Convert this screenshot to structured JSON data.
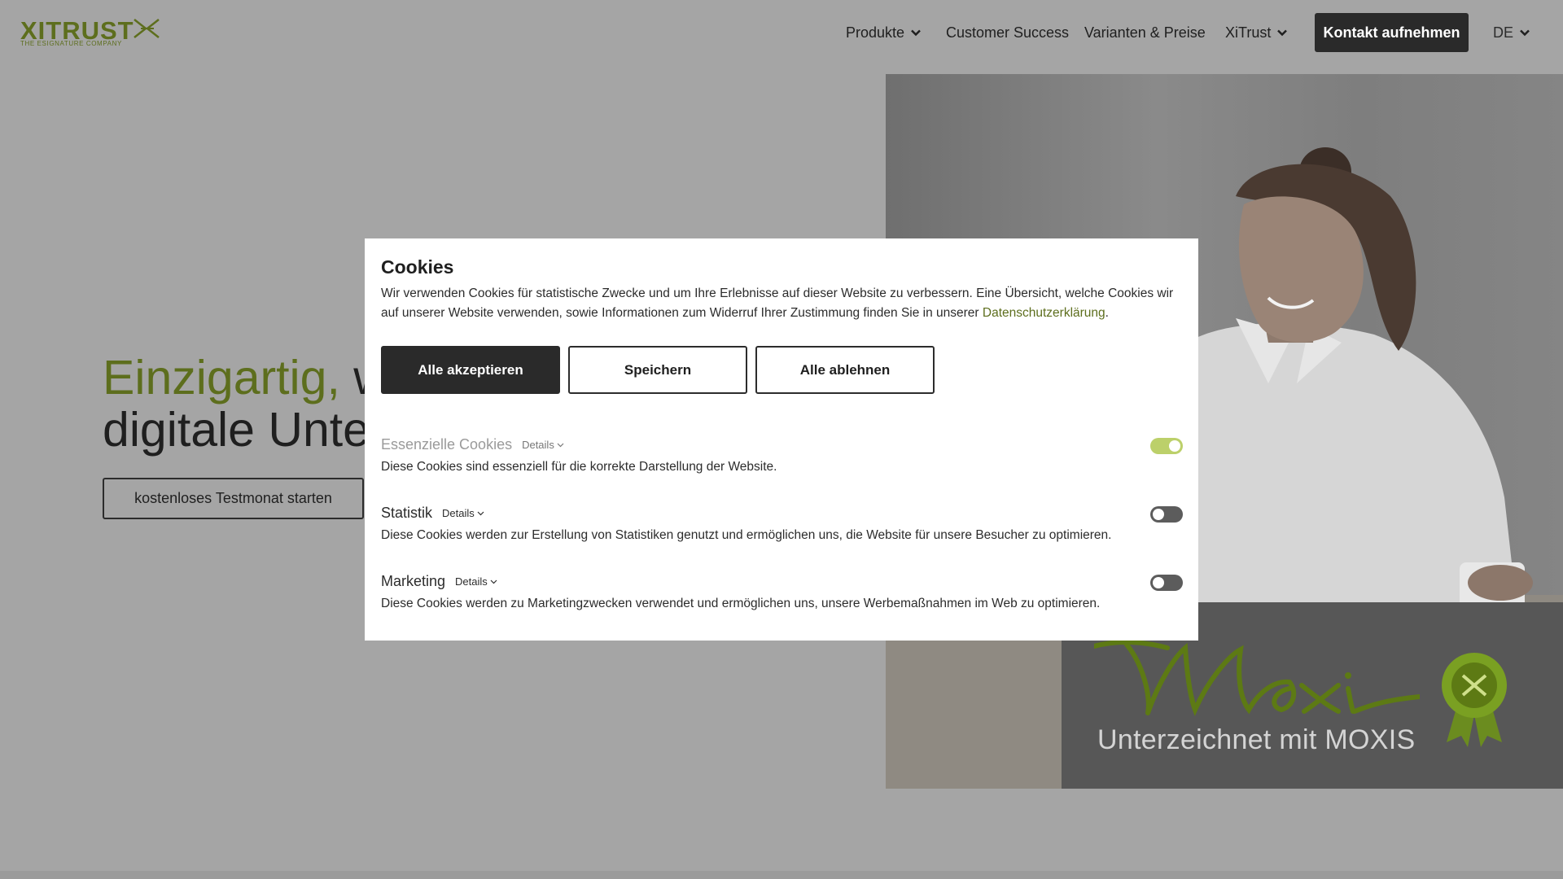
{
  "header": {
    "logo_text": "XITRUST",
    "logo_tagline": "THE ESIGNATURE COMPANY",
    "nav": [
      {
        "label": "Produkte",
        "has_dropdown": true
      },
      {
        "label": "Customer Success",
        "has_dropdown": false
      },
      {
        "label": "Varianten & Preise",
        "has_dropdown": false
      },
      {
        "label": "XiTrust",
        "has_dropdown": true
      }
    ],
    "contact_button": "Kontakt aufnehmen",
    "language": "DE"
  },
  "hero": {
    "title_accent": "Einzigartig,",
    "title_line1_rest": " w",
    "title_line2": "digitale Unte",
    "cta_button": "kostenloses Testmonat starten"
  },
  "moxis_badge": {
    "signature": "Moxis",
    "caption": "Unterzeichnet mit MOXIS"
  },
  "cookie_dialog": {
    "title": "Cookies",
    "text": "Wir verwenden Cookies für statistische Zwecke und um Ihre Erlebnisse auf dieser Website zu verbessern. Eine Übersicht, welche Cookies wir auf unserer Website verwenden, sowie Informationen zum Widerruf Ihrer Zustimmung finden Sie in unserer ",
    "privacy_link": "Datenschutzerklärung",
    "text_end": ".",
    "buttons": {
      "accept_all": "Alle akzeptieren",
      "save": "Speichern",
      "reject_all": "Alle ablehnen"
    },
    "categories": [
      {
        "title": "Essenzielle Cookies",
        "details": "Details",
        "description": "Diese Cookies sind essenziell für die korrekte Darstellung der Website.",
        "enabled": true,
        "locked": true
      },
      {
        "title": "Statistik",
        "details": "Details",
        "description": "Diese Cookies werden zur Erstellung von Statistiken genutzt und ermöglichen uns, die Website für unsere Besucher zu optimieren.",
        "enabled": false,
        "locked": false
      },
      {
        "title": "Marketing",
        "details": "Details",
        "description": "Diese Cookies werden zu Marketingzwecken verwendet und ermöglichen uns, unsere Werbemaßnahmen im Web zu optimieren.",
        "enabled": false,
        "locked": false
      }
    ]
  },
  "colors": {
    "brand_green": "#5d6e1d",
    "toggle_on": "#bcd06a",
    "toggle_off": "#5c5c5c",
    "dark_button": "#2a2a2a",
    "overlay_bg": "#a5a5a5"
  }
}
